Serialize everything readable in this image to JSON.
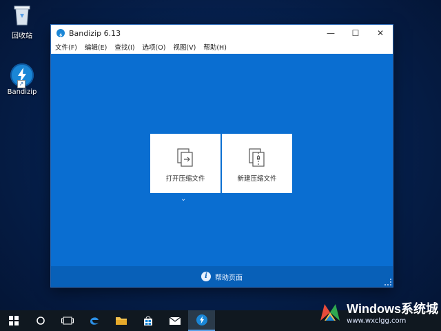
{
  "desktop": {
    "recycle_bin_label": "回收站",
    "bandizip_label": "Bandizip"
  },
  "window": {
    "title": "Bandizip 6.13",
    "minimize_glyph": "—",
    "maximize_glyph": "☐",
    "close_glyph": "✕",
    "menu": [
      "文件(F)",
      "编辑(E)",
      "查找(I)",
      "选项(O)",
      "视图(V)",
      "帮助(H)"
    ]
  },
  "main": {
    "open_archive_label": "打开压缩文件",
    "new_archive_label": "新建压缩文件",
    "expand_glyph": "⌄",
    "help_page_label": "帮助页面",
    "info_glyph": "i"
  },
  "taskbar": {
    "items": [
      "start-icon",
      "cortana-icon",
      "task-view-icon",
      "edge-icon",
      "file-explorer-icon",
      "store-icon",
      "mail-icon",
      "bandizip-icon"
    ]
  },
  "watermark": {
    "title": "Windows系统城",
    "url": "www.wxclgg.com"
  },
  "colors": {
    "client_blue": "#0a6ed1",
    "footer_blue": "#0860b8",
    "taskbar": "#101820"
  }
}
